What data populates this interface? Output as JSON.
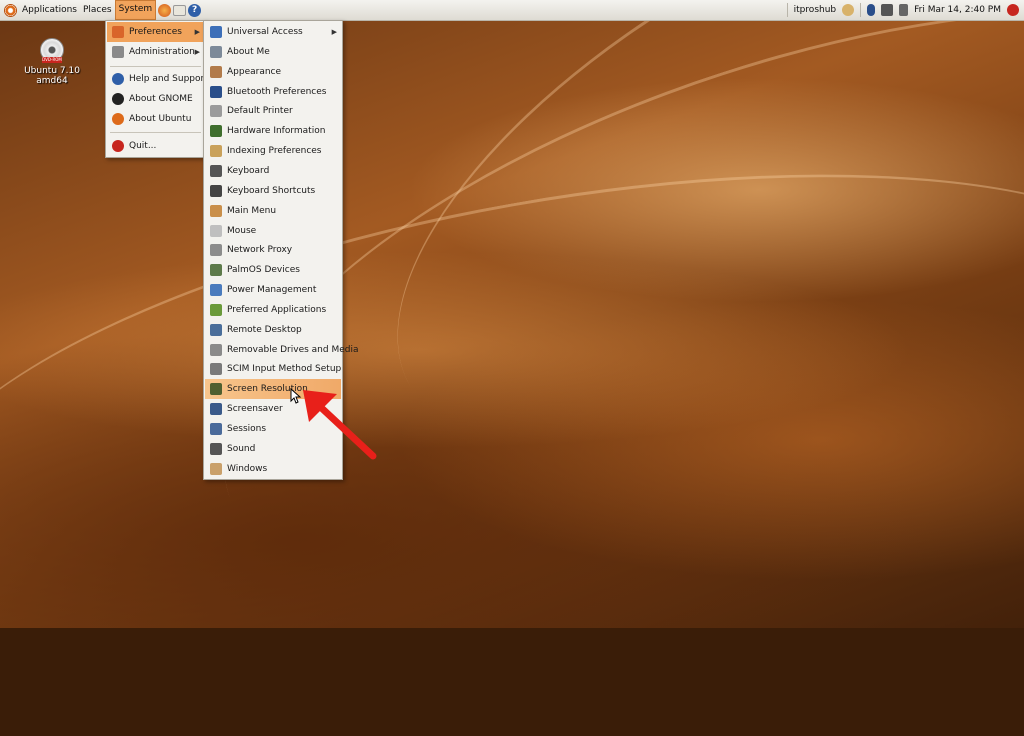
{
  "top_panel": {
    "applications_label": "Applications",
    "places_label": "Places",
    "system_label": "System",
    "username": "itproshub",
    "clock": "Fri Mar 14,  2:40 PM"
  },
  "desktop": {
    "dvd_label": "DVD-ROM",
    "dvd_name": "Ubuntu 7.10 amd64"
  },
  "system_menu": {
    "items": [
      {
        "label": "Preferences",
        "icon": "preferences-icon",
        "color": "#d9652a",
        "submenu": true
      },
      {
        "label": "Administration",
        "icon": "administration-icon",
        "color": "#8a8a8a",
        "submenu": true
      },
      {
        "label": "Help and Support",
        "icon": "help-icon",
        "color": "#2f5fa8"
      },
      {
        "label": "About GNOME",
        "icon": "gnome-foot-icon",
        "color": "#222222"
      },
      {
        "label": "About Ubuntu",
        "icon": "ubuntu-icon",
        "color": "#dd6a1a"
      },
      {
        "label": "Quit...",
        "icon": "power-icon",
        "color": "#c7261f"
      }
    ]
  },
  "preferences_menu": {
    "items": [
      {
        "label": "Universal Access",
        "icon": "universal-access-icon",
        "color": "#3d6fb8",
        "submenu": true
      },
      {
        "label": "About Me",
        "icon": "about-me-icon",
        "color": "#7d8a99"
      },
      {
        "label": "Appearance",
        "icon": "appearance-icon",
        "color": "#b27b4a"
      },
      {
        "label": "Bluetooth Preferences",
        "icon": "bluetooth-icon",
        "color": "#2a4e8a"
      },
      {
        "label": "Default Printer",
        "icon": "printer-icon",
        "color": "#9b9b9b"
      },
      {
        "label": "Hardware Information",
        "icon": "hardware-icon",
        "color": "#3f6e2d"
      },
      {
        "label": "Indexing Preferences",
        "icon": "indexing-icon",
        "color": "#c9a15a"
      },
      {
        "label": "Keyboard",
        "icon": "keyboard-icon",
        "color": "#555555"
      },
      {
        "label": "Keyboard Shortcuts",
        "icon": "keyboard-shortcuts-icon",
        "color": "#444444"
      },
      {
        "label": "Main Menu",
        "icon": "main-menu-icon",
        "color": "#c98f4a"
      },
      {
        "label": "Mouse",
        "icon": "mouse-icon",
        "color": "#bfbfbf"
      },
      {
        "label": "Network Proxy",
        "icon": "network-proxy-icon",
        "color": "#8c8c8c"
      },
      {
        "label": "PalmOS Devices",
        "icon": "palm-icon",
        "color": "#5d7a4a"
      },
      {
        "label": "Power Management",
        "icon": "power-management-icon",
        "color": "#4a7bbd"
      },
      {
        "label": "Preferred Applications",
        "icon": "preferred-apps-icon",
        "color": "#6a9a3a"
      },
      {
        "label": "Remote Desktop",
        "icon": "remote-desktop-icon",
        "color": "#4a6e9a"
      },
      {
        "label": "Removable Drives and Media",
        "icon": "removable-media-icon",
        "color": "#8a8a8a"
      },
      {
        "label": "SCIM Input Method Setup",
        "icon": "scim-icon",
        "color": "#7a7a7a"
      },
      {
        "label": "Screen Resolution",
        "icon": "screen-resolution-icon",
        "color": "#4f5f2f",
        "selected": true
      },
      {
        "label": "Screensaver",
        "icon": "screensaver-icon",
        "color": "#3a5a8a"
      },
      {
        "label": "Sessions",
        "icon": "sessions-icon",
        "color": "#4a6a9a"
      },
      {
        "label": "Sound",
        "icon": "sound-icon",
        "color": "#555555"
      },
      {
        "label": "Windows",
        "icon": "windows-icon",
        "color": "#c9a06a"
      }
    ]
  },
  "colors": {
    "menu_highlight": "#f1a35b",
    "arrow": "#e8201a"
  }
}
